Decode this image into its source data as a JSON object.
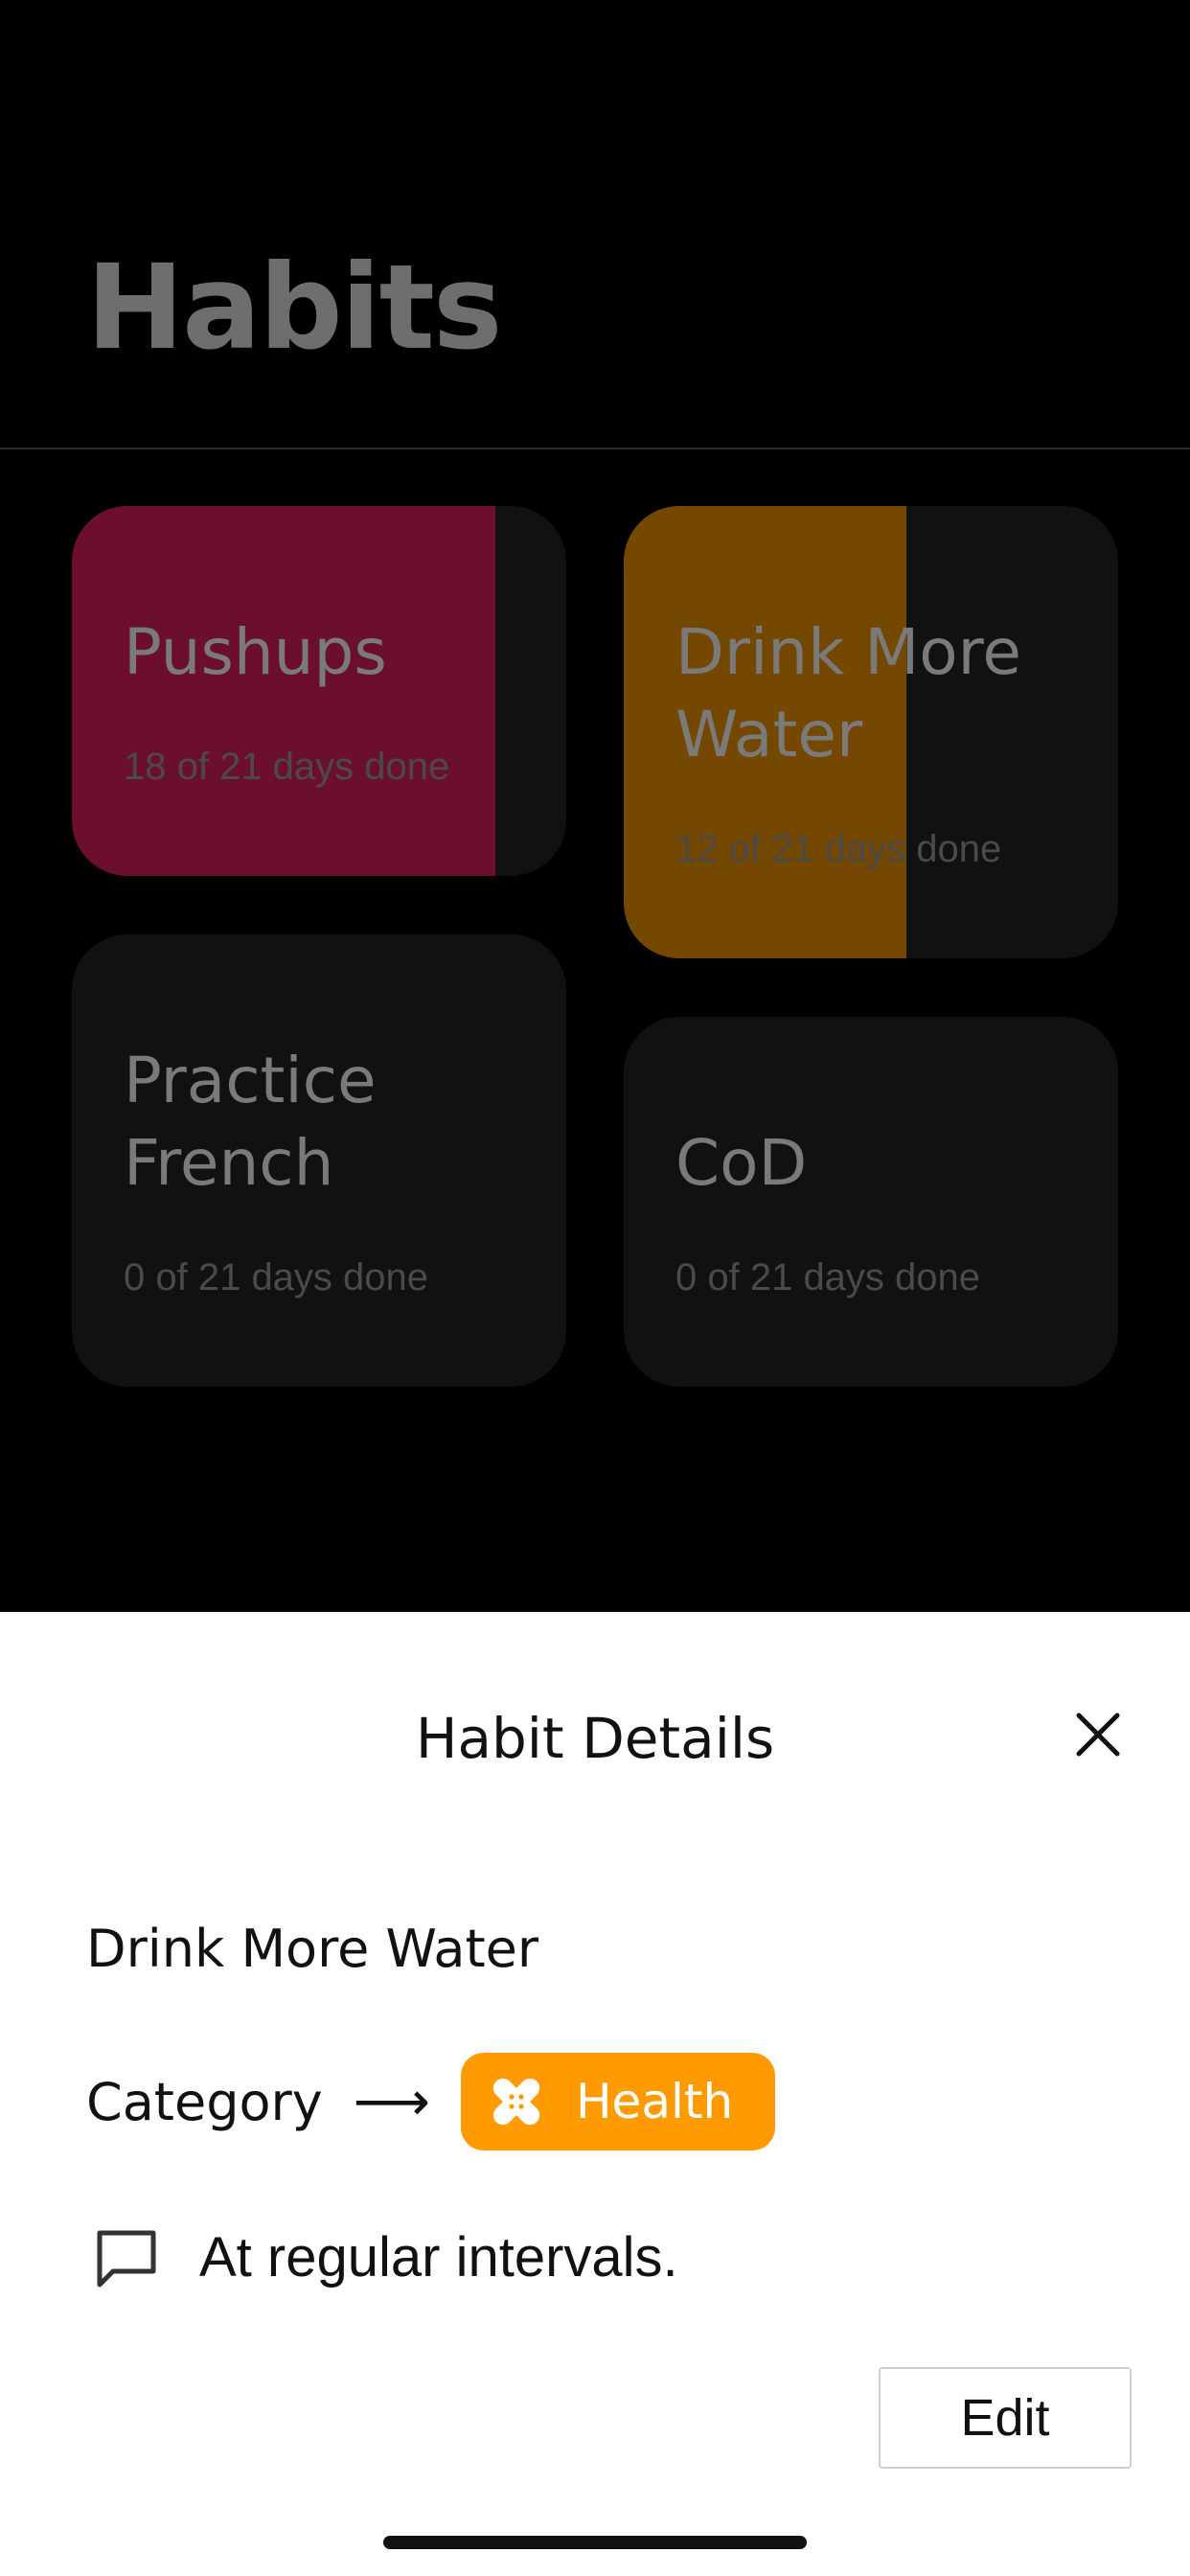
{
  "header": {
    "title": "Habits"
  },
  "habits": [
    {
      "name": "Pushups",
      "progress_text": "18 of 21 days done",
      "done": 18,
      "total": 21,
      "color": "#6c0f2e"
    },
    {
      "name": "Drink More Water",
      "progress_text": "12 of 21 days done",
      "done": 12,
      "total": 21,
      "color": "#754800"
    },
    {
      "name": "Practice French",
      "progress_text": "0 of 21 days done",
      "done": 0,
      "total": 21,
      "color": "#6c0f2e"
    },
    {
      "name": "CoD",
      "progress_text": "0 of 21 days done",
      "done": 0,
      "total": 21,
      "color": "#754800"
    }
  ],
  "sheet": {
    "title": "Habit Details",
    "habit_name": "Drink More Water",
    "category_label": "Category",
    "category_value": "Health",
    "category_color": "#ff9b00",
    "category_icon": "bandage-icon",
    "note": "At regular intervals.",
    "edit_label": "Edit"
  }
}
